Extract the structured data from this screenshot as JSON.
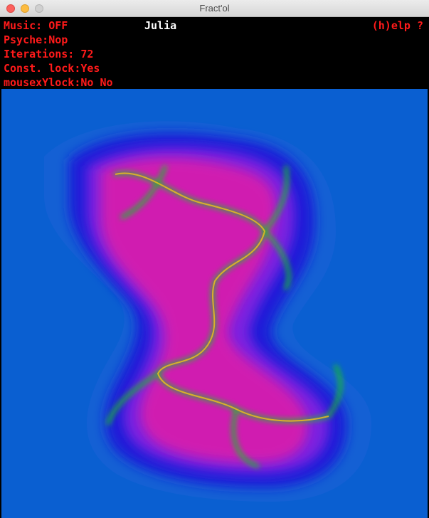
{
  "window": {
    "title": "Fract'ol"
  },
  "hud": {
    "music": "Music: OFF",
    "psyche": "Psyche:Nop",
    "iterations": "Iterations: 72",
    "const_lock": "Const. lock:Yes",
    "mouse_lock": "mousexYlock:No No",
    "mode": "Julia",
    "help": "(h)elp ?"
  },
  "colors": {
    "hud_text": "#ff1a1a",
    "outer_blue": "#0a5fd1",
    "deep_blue": "#1f1fd8",
    "violet": "#7a22e0",
    "magenta": "#e01aa8",
    "core_green": "#1fbf2a"
  }
}
